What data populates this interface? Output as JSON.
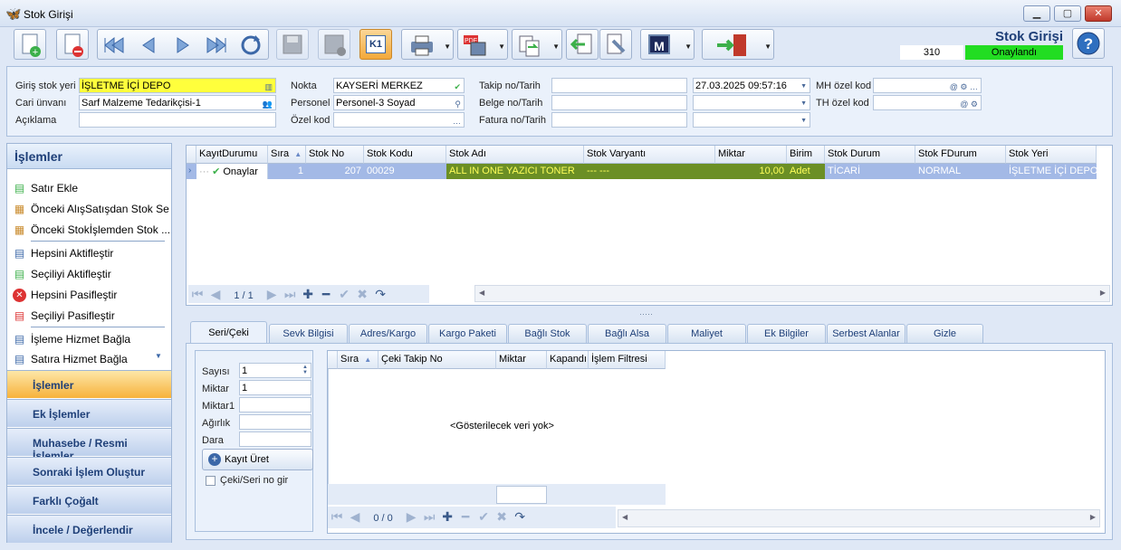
{
  "window": {
    "title": "Stok Girişi",
    "minimize": "▁",
    "maximize": "▢",
    "close": "✕"
  },
  "header": {
    "form_title": "Stok Girişi",
    "record_no": "310",
    "status": "Onaylandı",
    "status_color": "#22dd22"
  },
  "toolbar": {
    "icons": [
      "new-document-icon",
      "delete-document-icon",
      "first-icon",
      "prev-icon",
      "next-icon",
      "last-icon",
      "refresh-icon",
      "save-icon",
      "save-close-icon",
      "k1-icon",
      "print-icon",
      "pdf-export-icon",
      "copy-icon",
      "back-icon",
      "tools-icon",
      "m-icon",
      "exit-icon"
    ],
    "k1_label": "K1",
    "m_label": "M"
  },
  "form": {
    "giris_stok_yeri_label": "Giriş stok yeri",
    "giris_stok_yeri": "İŞLETME İÇİ DEPO",
    "cari_unvani_label": "Cari ünvanı",
    "cari_unvani": "Sarf Malzeme Tedarikçisi-1",
    "aciklama_label": "Açıklama",
    "aciklama": "",
    "nokta_label": "Nokta",
    "nokta": "KAYSERİ MERKEZ",
    "personel_label": "Personel",
    "personel": "Personel-3 Soyad",
    "ozel_kod_label": "Özel kod",
    "ozel_kod": "",
    "takip_label": "Takip no/Tarih",
    "takip": "",
    "belge_label": "Belge no/Tarih",
    "belge": "",
    "fatura_label": "Fatura no/Tarih",
    "fatura": "",
    "tarih1": "27.03.2025 09:57:16",
    "tarih2": "",
    "tarih3": "",
    "mh_label": "MH özel kod",
    "mh": "",
    "th_label": "TH özel kod",
    "th": ""
  },
  "left_panel": {
    "title": "İşlemler",
    "items": [
      {
        "label": "Satır Ekle"
      },
      {
        "label": "Önceki AlışSatışdan Stok Seç"
      },
      {
        "label": "Önceki Stokİşlemden Stok ..."
      },
      {
        "label": "Hepsini Aktifleştir"
      },
      {
        "label": "Seçiliyi Aktifleştir"
      },
      {
        "label": "Hepsini Pasifleştir"
      },
      {
        "label": "Seçiliyi Pasifleştir"
      },
      {
        "label": "İşleme Hizmet Bağla"
      },
      {
        "label": "Satıra Hizmet Bağla"
      }
    ],
    "nav": [
      "İşlemler",
      "Ek İşlemler",
      "Muhasebe / Resmi İşlemler",
      "Sonraki İşlem Oluştur",
      "Farklı Çoğalt",
      "İncele / Değerlendir"
    ]
  },
  "grid": {
    "columns": [
      "KayıtDurumu",
      "Sıra",
      "Stok No",
      "Stok Kodu",
      "Stok Adı",
      "Stok Varyantı",
      "Miktar",
      "Birim",
      "Stok Durum",
      "Stok FDurum",
      "Stok Yeri"
    ],
    "row": {
      "durum": "Onaylar",
      "sira": "1",
      "stok_no": "207",
      "stok_kodu": "00029",
      "stok_adi": "ALL IN ONE YAZICI TONER",
      "varyant": "--- ---",
      "miktar": "10,00",
      "birim": "Adet",
      "stok_durum": "TİCARİ",
      "fdurum": "NORMAL",
      "yeri": "İŞLETME İÇİ DEPO"
    },
    "pager": "1 / 1"
  },
  "tabs": [
    "Seri/Çeki",
    "Sevk Bilgisi",
    "Adres/Kargo",
    "Kargo Paketi",
    "Bağlı Stok",
    "Bağlı Alsa",
    "Maliyet",
    "Ek Bilgiler",
    "Serbest Alanlar",
    "Gizle"
  ],
  "seri": {
    "sayisi_label": "Sayısı",
    "sayisi": "1",
    "miktar_label": "Miktar",
    "miktar": "1",
    "miktar1_label": "Miktar1",
    "miktar1": "",
    "agirlik_label": "Ağırlık",
    "agirlik": "",
    "dara_label": "Dara",
    "dara": "",
    "kayit_uret": "Kayıt Üret",
    "ceki_checkbox": "Çeki/Seri no gir"
  },
  "grid2": {
    "columns": [
      "Sıra",
      "Çeki Takip No",
      "Miktar",
      "Kapandı",
      "İşlem Filtresi"
    ],
    "empty": "<Gösterilecek veri yok>",
    "pager": "0 / 0"
  }
}
